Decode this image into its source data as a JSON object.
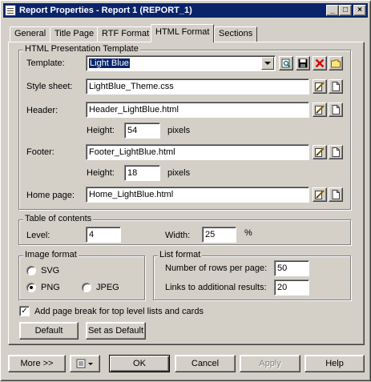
{
  "window": {
    "title": "Report Properties - Report 1 (REPORT_1)"
  },
  "titlebar_buttons": {
    "minimize": "_",
    "maximize": "□",
    "close": "×"
  },
  "tabs": [
    {
      "label": "General"
    },
    {
      "label": "Title Page"
    },
    {
      "label": "RTF Format"
    },
    {
      "label": "HTML Format"
    },
    {
      "label": "Sections"
    }
  ],
  "template_group": {
    "title": "HTML Presentation Template",
    "template_label": "Template:",
    "template_value": "Light Blue",
    "stylesheet_label": "Style sheet:",
    "stylesheet_value": "LightBlue_Theme.css",
    "header_label": "Header:",
    "header_value": "Header_LightBlue.html",
    "header_height_label": "Height:",
    "header_height_value": "54",
    "header_height_unit": "pixels",
    "footer_label": "Footer:",
    "footer_value": "Footer_LightBlue.html",
    "footer_height_label": "Height:",
    "footer_height_value": "18",
    "footer_height_unit": "pixels",
    "homepage_label": "Home page:",
    "homepage_value": "Home_LightBlue.html"
  },
  "toc_group": {
    "title": "Table of contents",
    "level_label": "Level:",
    "level_value": "4",
    "width_label": "Width:",
    "width_value": "25",
    "width_unit": "%"
  },
  "image_group": {
    "title": "Image format",
    "options": [
      "SVG",
      "PNG",
      "JPEG"
    ],
    "selected": "PNG"
  },
  "list_group": {
    "title": "List format",
    "rows_label": "Number of rows per page:",
    "rows_value": "50",
    "links_label": "Links to additional results:",
    "links_value": "20"
  },
  "page_break": {
    "label": "Add page break for top level lists and cards",
    "checked": true
  },
  "buttons": {
    "default": "Default",
    "set_as_default": "Set as Default",
    "more": "More >>",
    "ok": "OK",
    "cancel": "Cancel",
    "apply": "Apply",
    "help": "Help"
  },
  "icons": {
    "preview": "preview-icon",
    "save": "save-icon",
    "delete": "delete-icon",
    "open": "folder-icon",
    "edit": "edit-icon",
    "new": "new-file-icon"
  }
}
